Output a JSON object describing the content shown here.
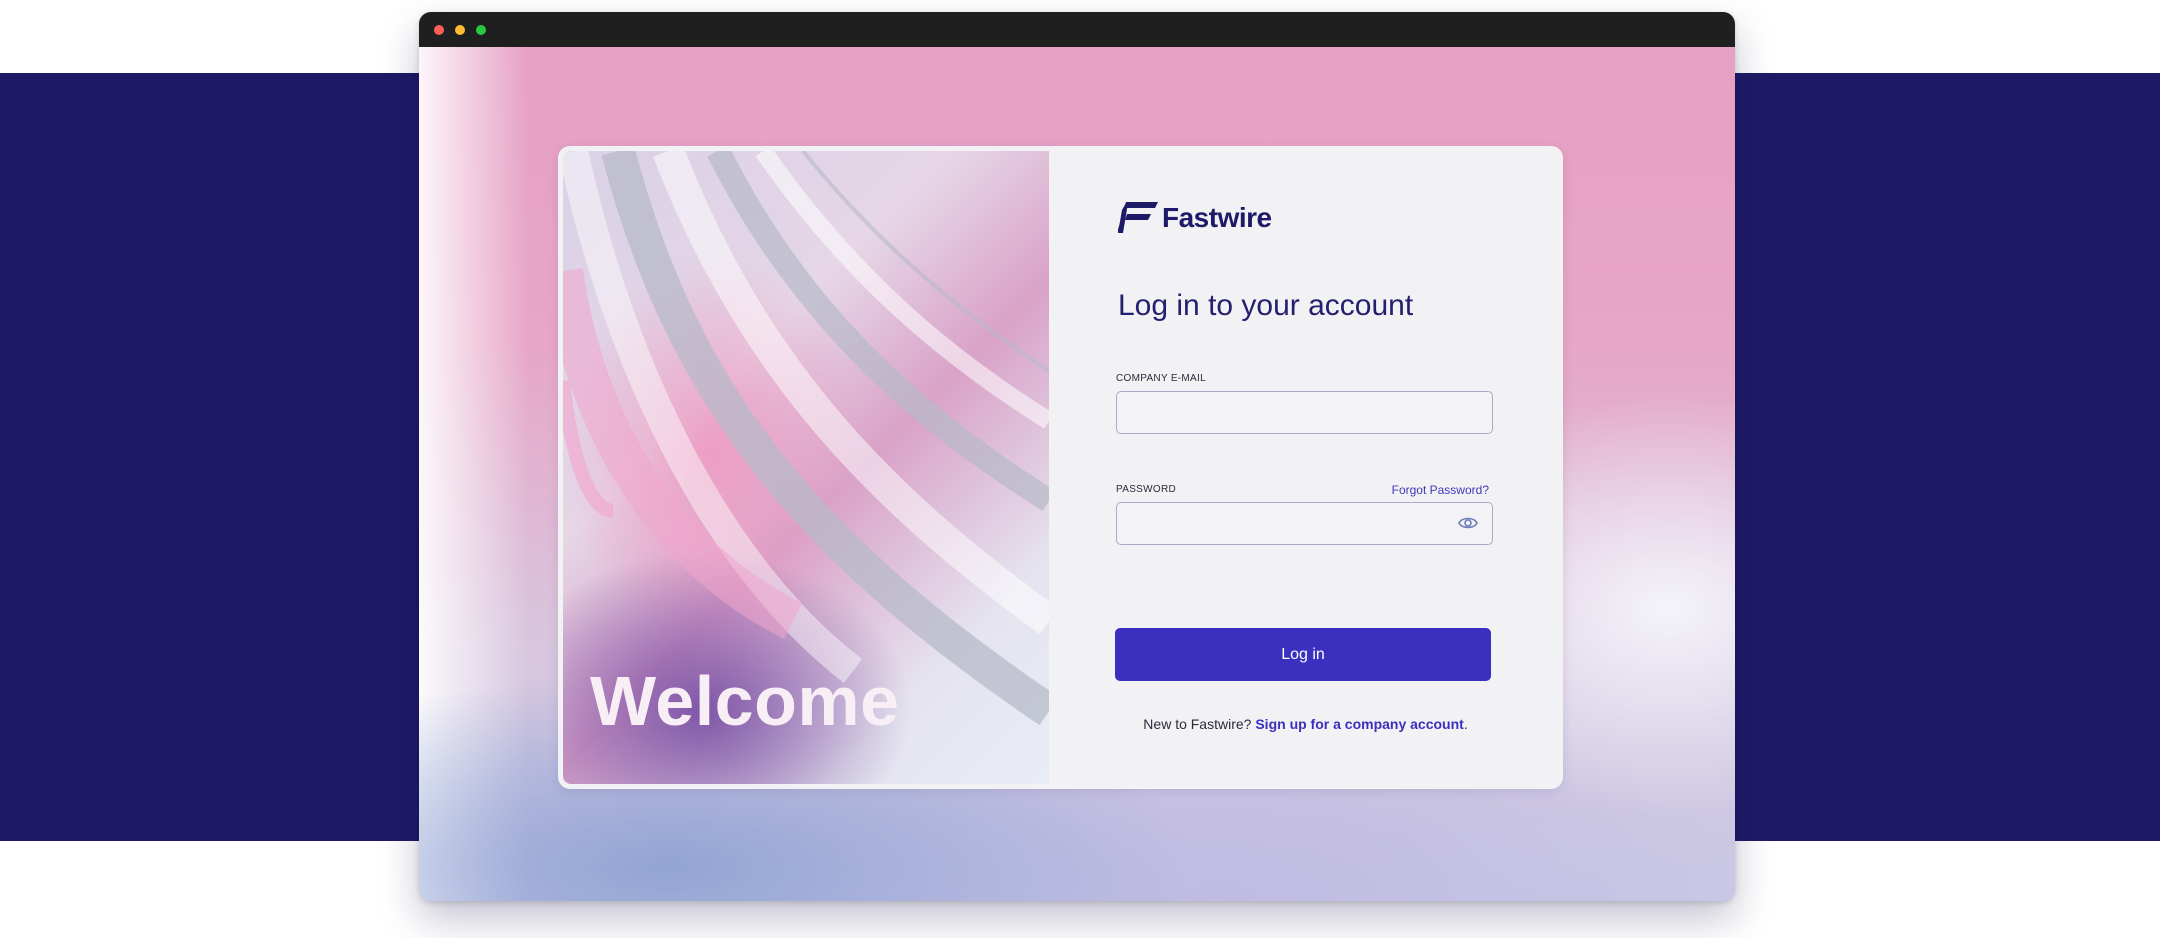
{
  "window": {
    "controls": [
      "close",
      "minimize",
      "zoom"
    ]
  },
  "hero": {
    "welcome_text": "Welcome"
  },
  "brand": {
    "logo_icon": "fastwire-f-icon",
    "name": "Fastwire"
  },
  "form": {
    "title": "Log in to your account",
    "email_label": "COMPANY E-MAIL",
    "email_value": "",
    "password_label": "PASSWORD",
    "password_value": "",
    "forgot_password": "Forgot Password?",
    "toggle_visibility_icon": "eye-icon",
    "login_button": "Log in",
    "signup_prompt": "New to Fastwire?",
    "signup_link": "Sign up for a company account",
    "signup_period": "."
  },
  "colors": {
    "navy": "#1e1a67",
    "accent": "#3b2fbf",
    "pink": "#e6a0c4"
  }
}
